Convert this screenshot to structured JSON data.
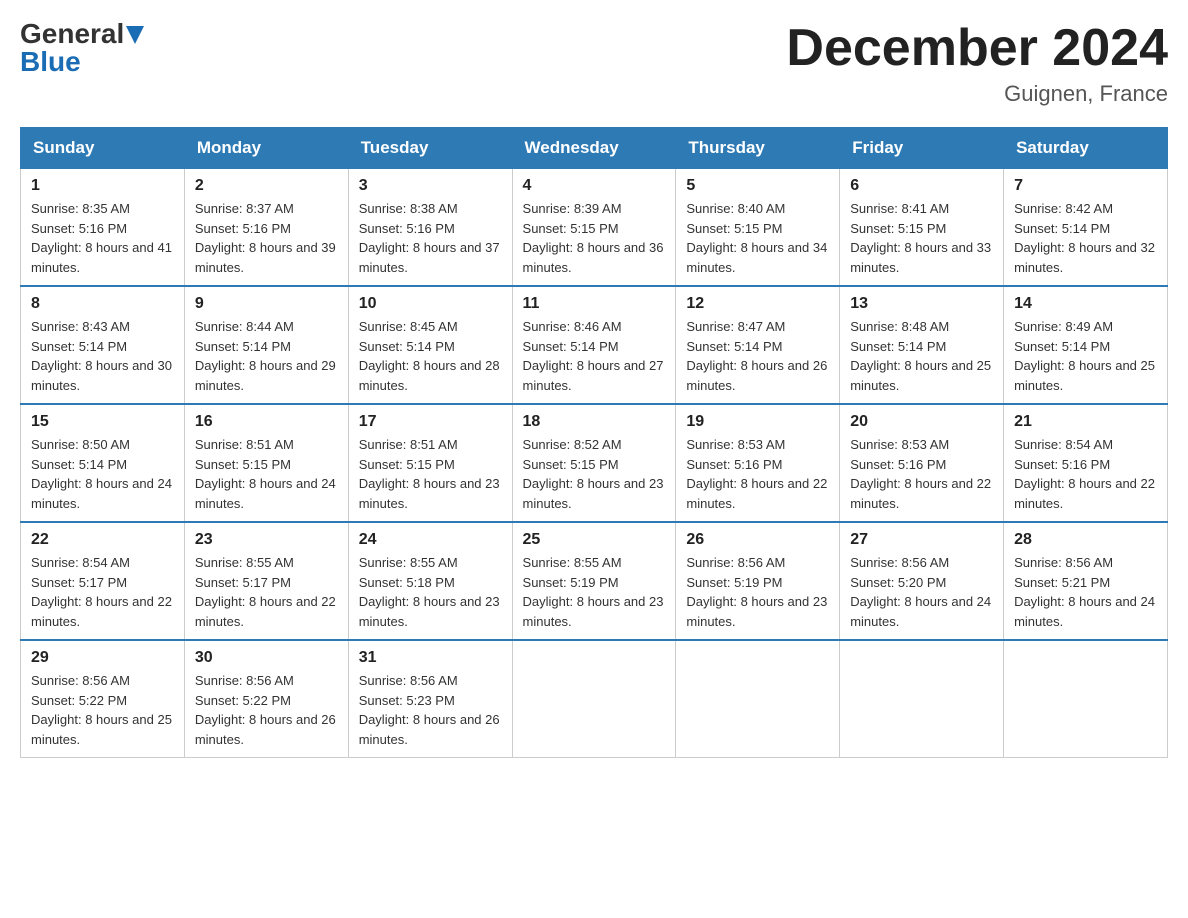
{
  "logo": {
    "general": "General",
    "blue": "Blue"
  },
  "title": "December 2024",
  "location": "Guignen, France",
  "days_of_week": [
    "Sunday",
    "Monday",
    "Tuesday",
    "Wednesday",
    "Thursday",
    "Friday",
    "Saturday"
  ],
  "weeks": [
    [
      {
        "day": "1",
        "sunrise": "8:35 AM",
        "sunset": "5:16 PM",
        "daylight": "8 hours and 41 minutes."
      },
      {
        "day": "2",
        "sunrise": "8:37 AM",
        "sunset": "5:16 PM",
        "daylight": "8 hours and 39 minutes."
      },
      {
        "day": "3",
        "sunrise": "8:38 AM",
        "sunset": "5:16 PM",
        "daylight": "8 hours and 37 minutes."
      },
      {
        "day": "4",
        "sunrise": "8:39 AM",
        "sunset": "5:15 PM",
        "daylight": "8 hours and 36 minutes."
      },
      {
        "day": "5",
        "sunrise": "8:40 AM",
        "sunset": "5:15 PM",
        "daylight": "8 hours and 34 minutes."
      },
      {
        "day": "6",
        "sunrise": "8:41 AM",
        "sunset": "5:15 PM",
        "daylight": "8 hours and 33 minutes."
      },
      {
        "day": "7",
        "sunrise": "8:42 AM",
        "sunset": "5:14 PM",
        "daylight": "8 hours and 32 minutes."
      }
    ],
    [
      {
        "day": "8",
        "sunrise": "8:43 AM",
        "sunset": "5:14 PM",
        "daylight": "8 hours and 30 minutes."
      },
      {
        "day": "9",
        "sunrise": "8:44 AM",
        "sunset": "5:14 PM",
        "daylight": "8 hours and 29 minutes."
      },
      {
        "day": "10",
        "sunrise": "8:45 AM",
        "sunset": "5:14 PM",
        "daylight": "8 hours and 28 minutes."
      },
      {
        "day": "11",
        "sunrise": "8:46 AM",
        "sunset": "5:14 PM",
        "daylight": "8 hours and 27 minutes."
      },
      {
        "day": "12",
        "sunrise": "8:47 AM",
        "sunset": "5:14 PM",
        "daylight": "8 hours and 26 minutes."
      },
      {
        "day": "13",
        "sunrise": "8:48 AM",
        "sunset": "5:14 PM",
        "daylight": "8 hours and 25 minutes."
      },
      {
        "day": "14",
        "sunrise": "8:49 AM",
        "sunset": "5:14 PM",
        "daylight": "8 hours and 25 minutes."
      }
    ],
    [
      {
        "day": "15",
        "sunrise": "8:50 AM",
        "sunset": "5:14 PM",
        "daylight": "8 hours and 24 minutes."
      },
      {
        "day": "16",
        "sunrise": "8:51 AM",
        "sunset": "5:15 PM",
        "daylight": "8 hours and 24 minutes."
      },
      {
        "day": "17",
        "sunrise": "8:51 AM",
        "sunset": "5:15 PM",
        "daylight": "8 hours and 23 minutes."
      },
      {
        "day": "18",
        "sunrise": "8:52 AM",
        "sunset": "5:15 PM",
        "daylight": "8 hours and 23 minutes."
      },
      {
        "day": "19",
        "sunrise": "8:53 AM",
        "sunset": "5:16 PM",
        "daylight": "8 hours and 22 minutes."
      },
      {
        "day": "20",
        "sunrise": "8:53 AM",
        "sunset": "5:16 PM",
        "daylight": "8 hours and 22 minutes."
      },
      {
        "day": "21",
        "sunrise": "8:54 AM",
        "sunset": "5:16 PM",
        "daylight": "8 hours and 22 minutes."
      }
    ],
    [
      {
        "day": "22",
        "sunrise": "8:54 AM",
        "sunset": "5:17 PM",
        "daylight": "8 hours and 22 minutes."
      },
      {
        "day": "23",
        "sunrise": "8:55 AM",
        "sunset": "5:17 PM",
        "daylight": "8 hours and 22 minutes."
      },
      {
        "day": "24",
        "sunrise": "8:55 AM",
        "sunset": "5:18 PM",
        "daylight": "8 hours and 23 minutes."
      },
      {
        "day": "25",
        "sunrise": "8:55 AM",
        "sunset": "5:19 PM",
        "daylight": "8 hours and 23 minutes."
      },
      {
        "day": "26",
        "sunrise": "8:56 AM",
        "sunset": "5:19 PM",
        "daylight": "8 hours and 23 minutes."
      },
      {
        "day": "27",
        "sunrise": "8:56 AM",
        "sunset": "5:20 PM",
        "daylight": "8 hours and 24 minutes."
      },
      {
        "day": "28",
        "sunrise": "8:56 AM",
        "sunset": "5:21 PM",
        "daylight": "8 hours and 24 minutes."
      }
    ],
    [
      {
        "day": "29",
        "sunrise": "8:56 AM",
        "sunset": "5:22 PM",
        "daylight": "8 hours and 25 minutes."
      },
      {
        "day": "30",
        "sunrise": "8:56 AM",
        "sunset": "5:22 PM",
        "daylight": "8 hours and 26 minutes."
      },
      {
        "day": "31",
        "sunrise": "8:56 AM",
        "sunset": "5:23 PM",
        "daylight": "8 hours and 26 minutes."
      },
      null,
      null,
      null,
      null
    ]
  ],
  "colors": {
    "header_bg": "#2e7ab5",
    "header_text": "#ffffff",
    "border": "#cccccc",
    "accent": "#1a6db5"
  }
}
